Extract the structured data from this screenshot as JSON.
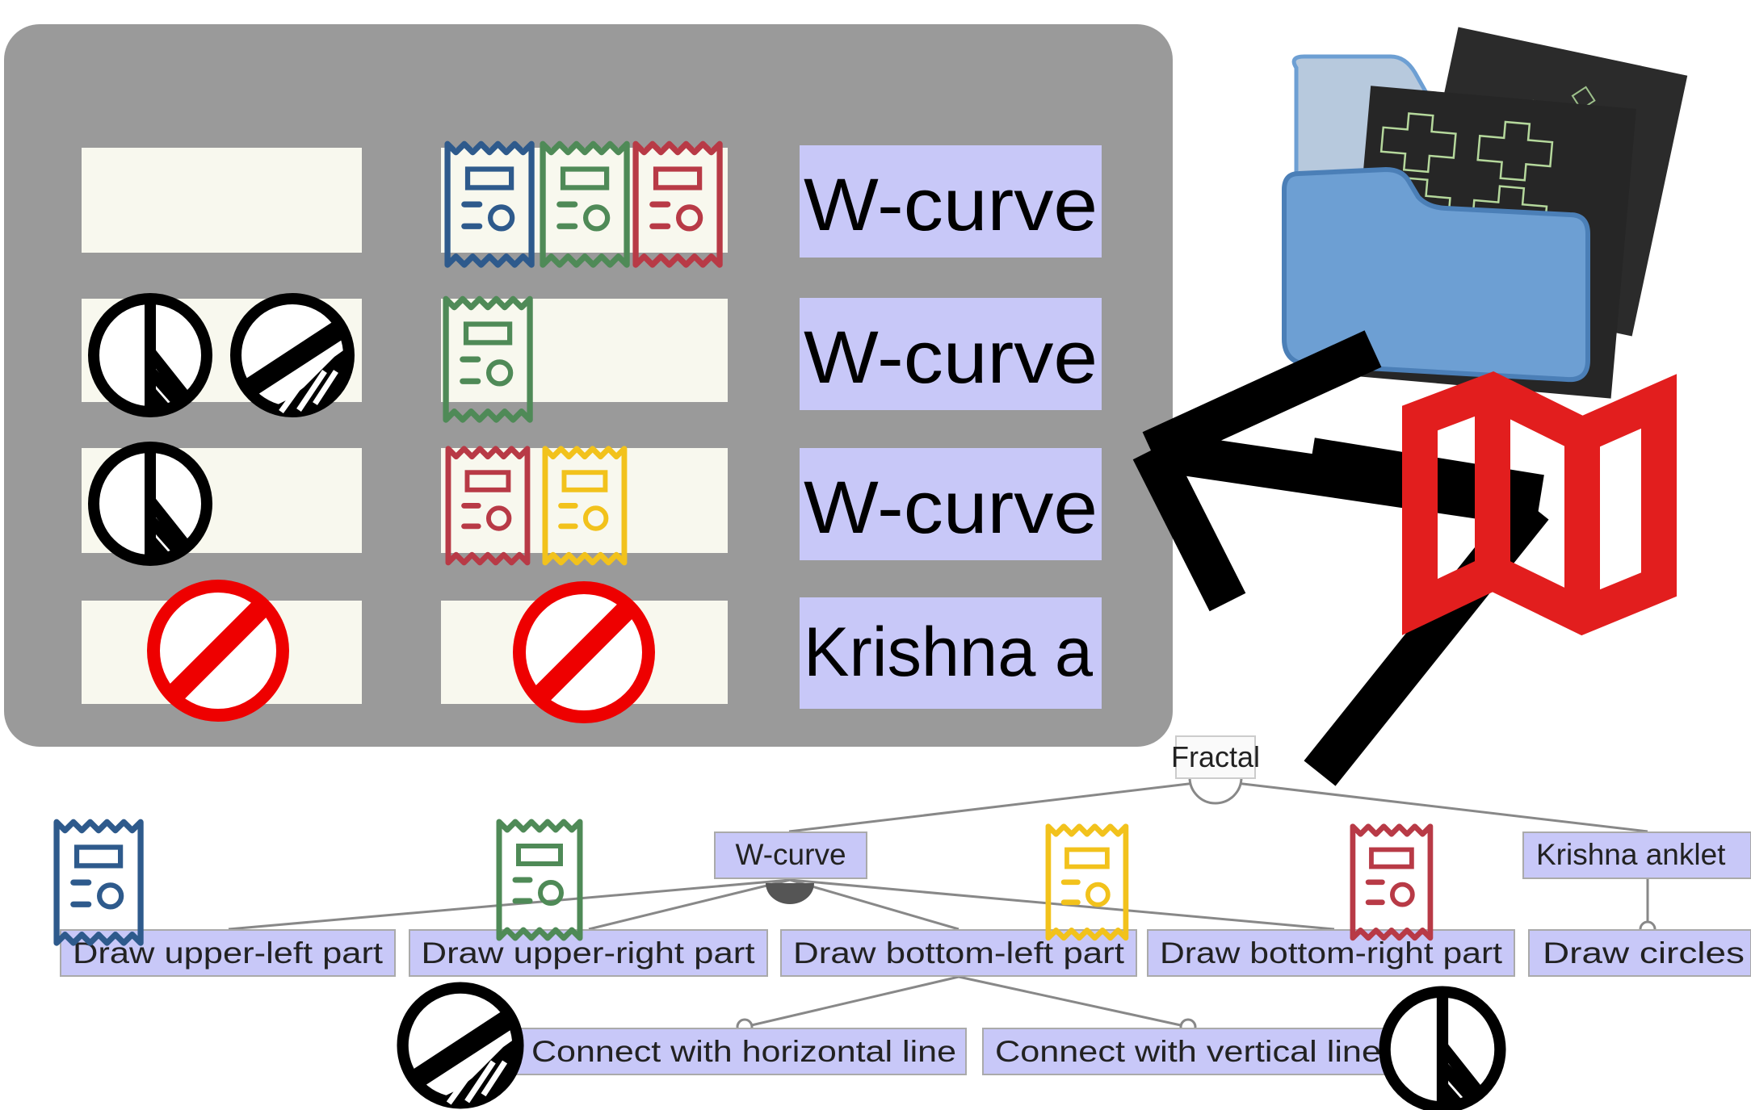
{
  "panel": {
    "rows": [
      {
        "label": "W-curve",
        "slot1_icons": [],
        "slot2_icons": [
          "receipt-blue",
          "receipt-green",
          "receipt-red"
        ]
      },
      {
        "label": "W-curve",
        "slot1_icons": [
          "peace-sign",
          "half-hatched-circle"
        ],
        "slot2_icons": [
          "receipt-green"
        ]
      },
      {
        "label": "W-curve",
        "slot1_icons": [
          "peace-sign"
        ],
        "slot2_icons": [
          "receipt-red",
          "receipt-yellow"
        ]
      },
      {
        "label": "Krishna a",
        "slot1_icons": [
          "prohibited-sign"
        ],
        "slot2_icons": [
          "prohibited-sign"
        ]
      }
    ]
  },
  "tree": {
    "root": "Fractal",
    "level1": [
      "W-curve",
      "Krishna anklet"
    ],
    "level2": [
      "Draw upper-left part",
      "Draw upper-right part",
      "Draw bottom-left part",
      "Draw bottom-right part",
      "Draw circles"
    ],
    "level3": [
      "Connect with horizontal line",
      "Connect with vertical line"
    ]
  },
  "decor": {
    "folder_icon": "folder-with-fractal-images",
    "map_icon": "folded-map-icon",
    "arrow_icon": "arrow-icon"
  },
  "colors": {
    "panel_bg": "#9a9a9a",
    "slot_bg": "#f8f8ee",
    "label_bg": "#c8c8f8",
    "receipt_blue": "#2e5a8c",
    "receipt_green": "#4f8a57",
    "receipt_red": "#b83a46",
    "receipt_yellow": "#f2c21c",
    "prohibit_red": "#ee0000",
    "map_red": "#e21e1e",
    "folder_blue": "#6d9fd3"
  }
}
